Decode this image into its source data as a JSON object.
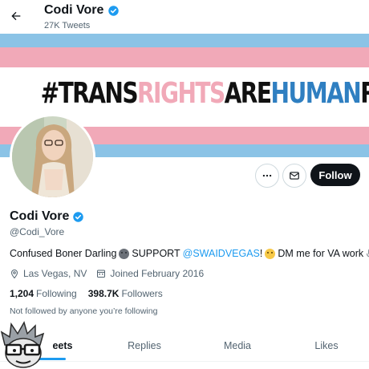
{
  "header": {
    "name": "Codi Vore",
    "tweet_count": "27K Tweets",
    "back_icon": "arrow-left-icon"
  },
  "banner": {
    "text_parts": [
      "#TRANS",
      "RIGHTS",
      "ARE",
      "HUMAN",
      "RIGHTS"
    ],
    "colors": {
      "light_blue": "#8bc3e6",
      "pink": "#f1a9b8",
      "white": "#ffffff",
      "text_black": "#111111",
      "text_pink": "#f1a9b8",
      "text_blue": "#2f7fc1"
    }
  },
  "actions": {
    "more_icon": "more-dots-icon",
    "message_icon": "envelope-icon",
    "follow_label": "Follow"
  },
  "profile": {
    "display_name": "Codi Vore",
    "handle": "@Codi_Vore",
    "bio_part1": "Confused Boner Darling",
    "bio_part2": "SUPPORT",
    "bio_link": "@SWAIDVEGAS",
    "bio_part3": "!",
    "bio_part4": "DM me for VA work",
    "location": "Las Vegas, NV",
    "joined": "Joined February 2016",
    "following_count": "1,204",
    "following_label": "Following",
    "followers_count": "398.7K",
    "followers_label": "Followers",
    "not_followed": "Not followed by anyone you’re following"
  },
  "tabs": [
    {
      "label": "Tweets",
      "visible_label": "eets"
    },
    {
      "label": "Replies"
    },
    {
      "label": "Media"
    },
    {
      "label": "Likes"
    }
  ],
  "accent_color": "#1d9bf0"
}
